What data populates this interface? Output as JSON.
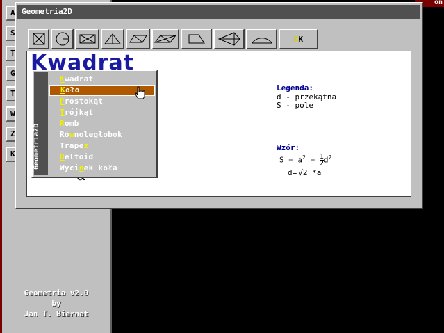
{
  "background_app": {
    "side_buttons": [
      "A",
      "S",
      "T",
      "G",
      "T",
      "W",
      "Z",
      "K"
    ],
    "credits": [
      "Geometria v2.0",
      "by",
      "Jan T. Biernat"
    ]
  },
  "red_tag": "on",
  "window": {
    "title": "Geometria2D",
    "toolbar": {
      "icons": [
        "square-icon",
        "circle-icon",
        "rectangle-icon",
        "triangle-icon",
        "rhombus-icon",
        "parallelogram-icon",
        "trapezoid-icon",
        "deltoid-icon",
        "circular-sector-icon"
      ],
      "ok_hotkey": "O",
      "ok_rest": "K"
    },
    "content": {
      "heading": "Kwadrat",
      "legend_title": "Legenda:",
      "legend_lines": [
        "d - przekątna",
        "S - pole"
      ],
      "formula_title": "Wzór:",
      "formula_s": "S = a",
      "formula_s_exp": "2",
      "formula_eq2": "=",
      "formula_frac_num": "1",
      "formula_frac_den": "2",
      "formula_d": "d",
      "formula_d_exp": "2",
      "formula_diag_left": "d=",
      "formula_diag_root": "2",
      "formula_diag_right": " *a",
      "alpha_symbol": "α"
    }
  },
  "menu": {
    "side_label": "Geometria2D",
    "items": [
      {
        "hotkey": "K",
        "rest": "wadrat",
        "selected": false
      },
      {
        "hotkey": "K",
        "rest": "oło",
        "selected": true
      },
      {
        "hotkey": "P",
        "rest": "rostokąt",
        "selected": false
      },
      {
        "hotkey": "T",
        "rest": "rójkąt",
        "selected": false
      },
      {
        "hotkey": "R",
        "rest": "omb",
        "selected": false
      },
      {
        "pre": "Ró",
        "hotkey": "w",
        "rest": "noległobok",
        "selected": false
      },
      {
        "pre": "Trape",
        "hotkey": "z",
        "rest": "",
        "selected": false
      },
      {
        "hotkey": "D",
        "rest": "eltoid",
        "selected": false
      },
      {
        "pre": "Wyci",
        "hotkey": "n",
        "rest": "ek koła",
        "selected": false
      }
    ]
  }
}
